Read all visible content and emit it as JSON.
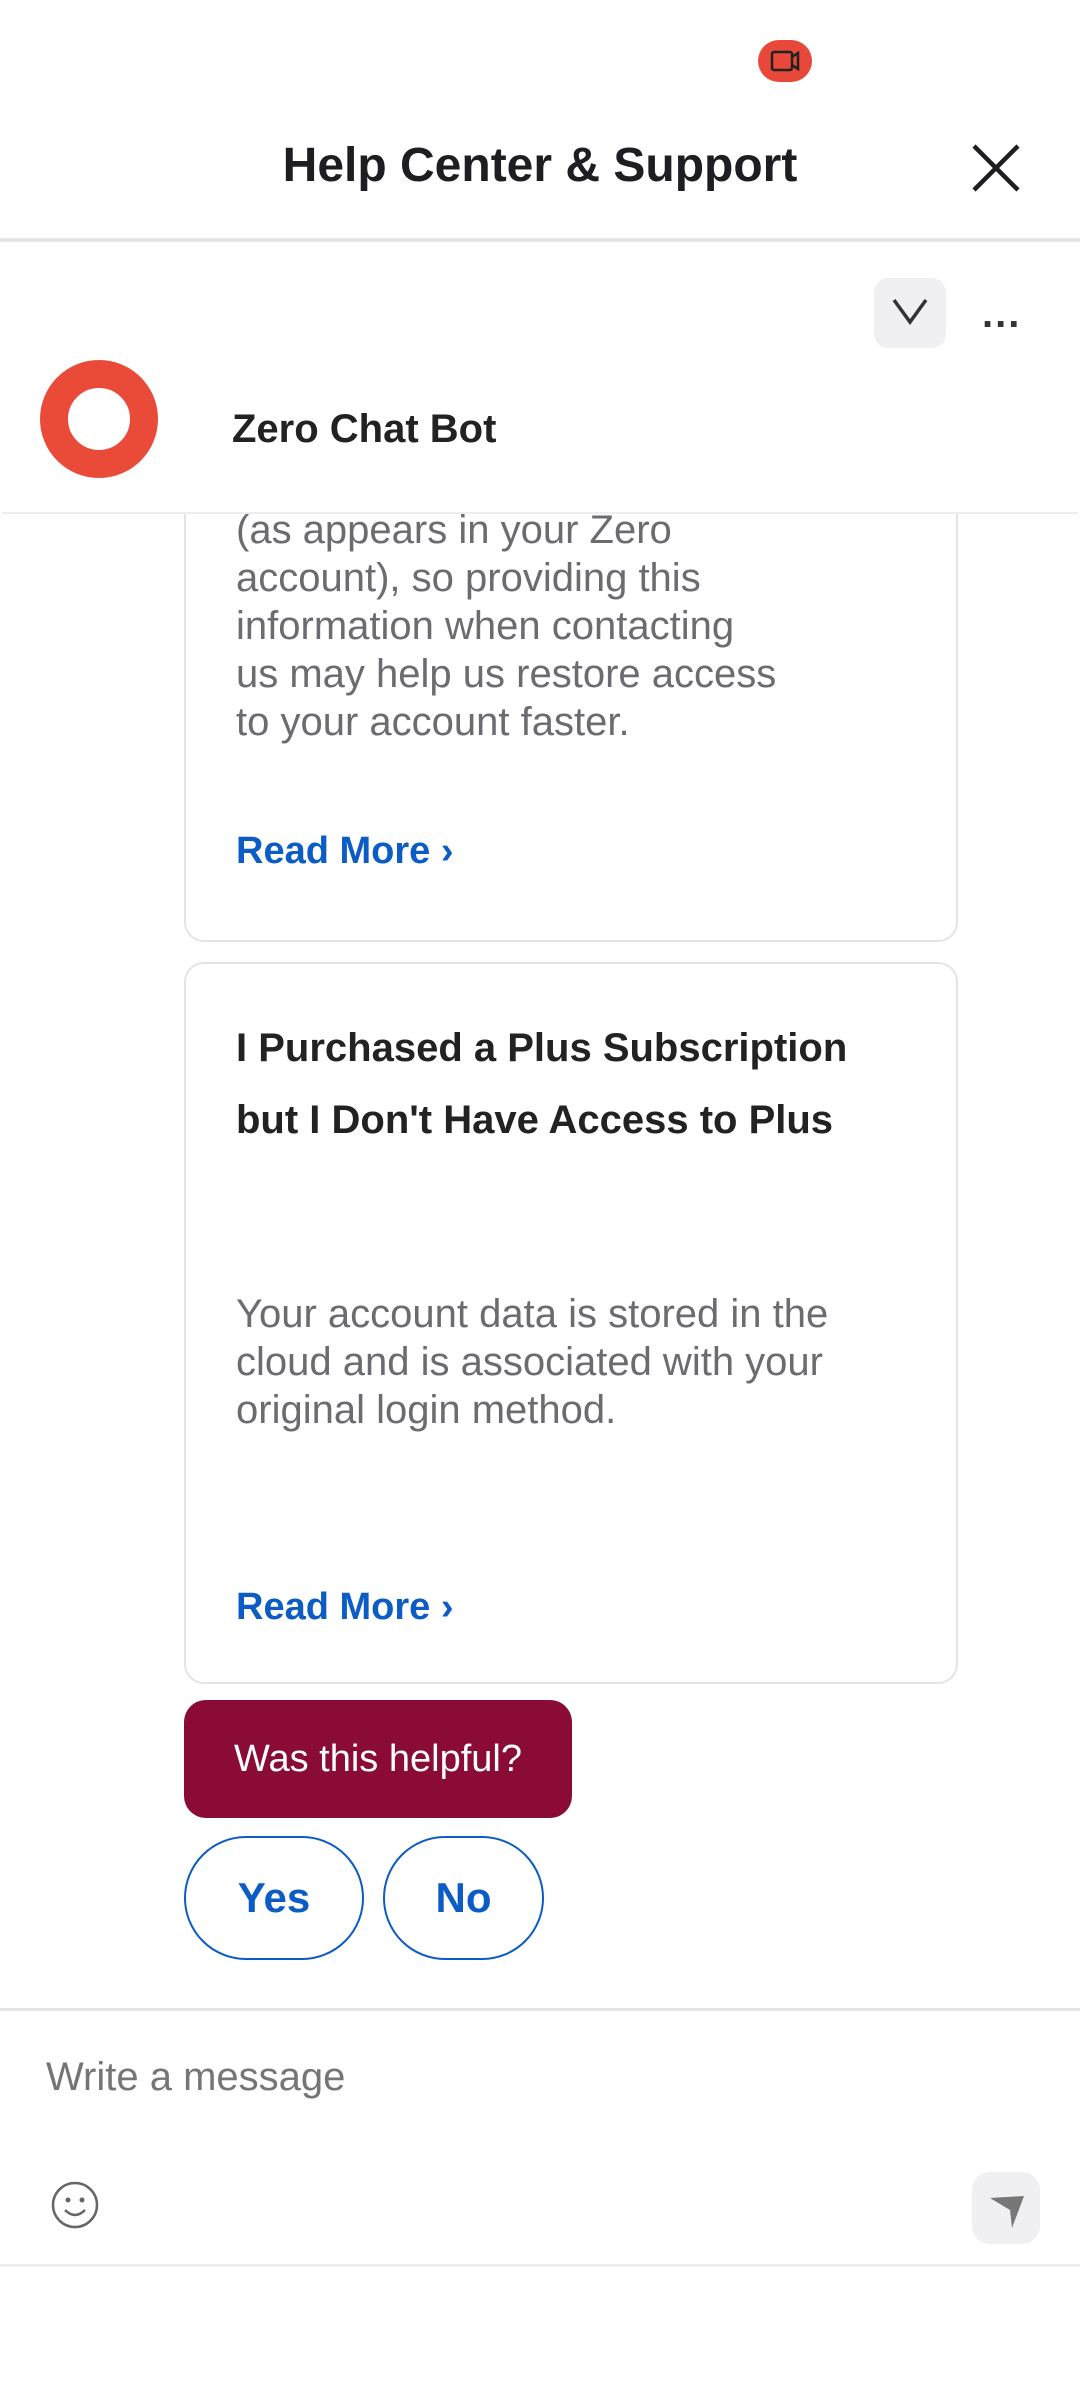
{
  "status_bar": {
    "icon": "screen-record-icon",
    "icon_color": "#e8483a"
  },
  "header": {
    "title": "Help Center & Support",
    "close_icon": "close-icon"
  },
  "chat_header": {
    "bot_name": "Zero Chat Bot",
    "avatar_color": "#ea4b39",
    "minimize_icon": "chevron-down-icon",
    "more_icon": "more-horizontal-icon",
    "more_label": "..."
  },
  "articles": [
    {
      "body_lines": [
        "(as appears in your Zero",
        "account), so providing this",
        "information when contacting",
        "us may help us restore access",
        "to your account faster."
      ],
      "read_more": "Read More ›"
    },
    {
      "title": "I Purchased a Plus Subscription but I Don't Have Access to Plus",
      "body": "Your account data is stored in the cloud and is associated with your original login method.",
      "read_more": "Read More ›"
    }
  ],
  "feedback": {
    "question": "Was this helpful?",
    "question_color": "#8a0b36",
    "yes": "Yes",
    "no": "No"
  },
  "composer": {
    "placeholder": "Write a message",
    "emoji_icon": "emoji-icon",
    "send_icon": "send-icon"
  },
  "accent": "#0b5cc4"
}
